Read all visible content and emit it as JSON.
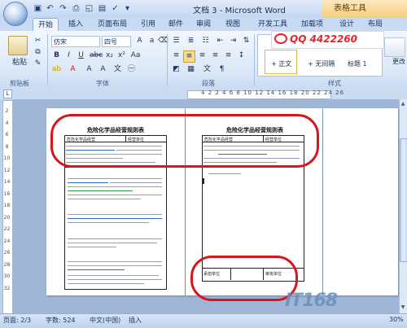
{
  "window": {
    "title": "文档 3 - Microsoft Word",
    "context_tab": "表格工具"
  },
  "tabs": [
    "开始",
    "插入",
    "页面布局",
    "引用",
    "邮件",
    "审阅",
    "视图",
    "开发工具",
    "加载项",
    "设计",
    "布局"
  ],
  "ribbon": {
    "clipboard": {
      "paste_label": "粘贴",
      "group_label": "剪贴板"
    },
    "font": {
      "font_name": "仿宋",
      "font_size": "四号",
      "group_label": "字体"
    },
    "paragraph": {
      "group_label": "段落"
    },
    "styles": {
      "group_label": "样式",
      "items": [
        "+ 正文",
        "+ 无间隔",
        "标题 1"
      ],
      "change_label": "更改"
    },
    "banner": "QQ 4422260"
  },
  "ruler": {
    "numbers": "4 2  2 4 6 8 10 12 14 16 18 20 22 24 26"
  },
  "vruler": {
    "numbers": "2 4 6 8 10 12 14 16 18 20 22 24 26 28 30 32 34 36 38 40 42 44 46 48"
  },
  "document": {
    "page1": {
      "title": "危险化学品经营规则表",
      "header_left": "危险化学品经营",
      "header_right": "经营单位"
    },
    "page2": {
      "title": "危险化学品经营规则表",
      "header_left": "危险化学品经营",
      "header_right": "经营单位",
      "footer_left": "承担单位",
      "footer_right": "审批单位"
    }
  },
  "statusbar": {
    "page": "页面: 2/3",
    "words": "字数: 524",
    "language": "中文(中国)",
    "mode": "插入",
    "zoom": "30%"
  },
  "watermark": "IT168",
  "colors": {
    "highlight_oval": "#d8141d",
    "context_tab": "#f4cf7c"
  }
}
